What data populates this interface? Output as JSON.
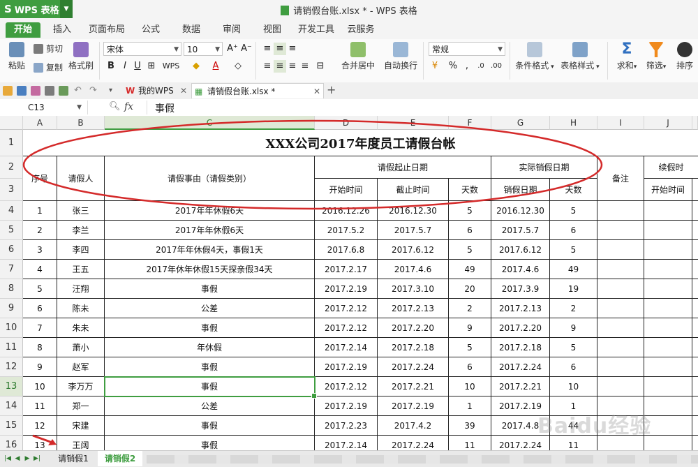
{
  "app": {
    "menu_label": "WPS 表格",
    "window_title": "请销假台账.xlsx * - WPS 表格"
  },
  "ribbon_tabs": [
    "开始",
    "插入",
    "页面布局",
    "公式",
    "数据",
    "审阅",
    "视图",
    "开发工具",
    "云服务"
  ],
  "ribbon": {
    "paste": "粘贴",
    "cut": "剪切",
    "copy": "复制",
    "format_painter": "格式刷",
    "font_name": "宋体",
    "font_size": "10",
    "merge_center": "合并居中",
    "wrap_text": "自动换行",
    "number_format": "常规",
    "conditional_format": "条件格式",
    "table_style": "表格样式",
    "sum": "求和",
    "filter": "筛选",
    "sort": "排序"
  },
  "doc_tabs": [
    {
      "label": "我的WPS"
    },
    {
      "label": "请销假台账.xlsx *"
    }
  ],
  "formula_bar": {
    "cell_ref": "C13",
    "fx": "fx",
    "content": "事假"
  },
  "columns": [
    "A",
    "B",
    "C",
    "D",
    "E",
    "F",
    "G",
    "H",
    "I",
    "J"
  ],
  "rows": [
    "1",
    "2",
    "3",
    "4",
    "5",
    "6",
    "7",
    "8",
    "9",
    "10",
    "11",
    "12",
    "13",
    "14",
    "15",
    "16"
  ],
  "sheet": {
    "title": "XXX公司2017年度员工请假台帐",
    "headers": {
      "seq": "序号",
      "person": "请假人",
      "reason": "请假事由（请假类别）",
      "leave_period": "请假起止日期",
      "start": "开始时间",
      "end": "截止时间",
      "days": "天数",
      "actual": "实际销假日期",
      "cancel_date": "销假日期",
      "actual_days": "天数",
      "note": "备注",
      "extend": "续假时",
      "extend_start": "开始时间"
    },
    "records": [
      [
        "1",
        "张三",
        "2017年年休假6天",
        "2016.12.26",
        "2016.12.30",
        "5",
        "2016.12.30",
        "5"
      ],
      [
        "2",
        "李兰",
        "2017年年休假6天",
        "2017.5.2",
        "2017.5.7",
        "6",
        "2017.5.7",
        "6"
      ],
      [
        "3",
        "李四",
        "2017年年休假4天，事假1天",
        "2017.6.8",
        "2017.6.12",
        "5",
        "2017.6.12",
        "5"
      ],
      [
        "4",
        "王五",
        "2017年休年休假15天探亲假34天",
        "2017.2.17",
        "2017.4.6",
        "49",
        "2017.4.6",
        "49"
      ],
      [
        "5",
        "汪翔",
        "事假",
        "2017.2.19",
        "2017.3.10",
        "20",
        "2017.3.9",
        "19"
      ],
      [
        "6",
        "陈未",
        "公差",
        "2017.2.12",
        "2017.2.13",
        "2",
        "2017.2.13",
        "2"
      ],
      [
        "7",
        "朱未",
        "事假",
        "2017.2.12",
        "2017.2.20",
        "9",
        "2017.2.20",
        "9"
      ],
      [
        "8",
        "萧小",
        "年休假",
        "2017.2.14",
        "2017.2.18",
        "5",
        "2017.2.18",
        "5"
      ],
      [
        "9",
        "赵军",
        "事假",
        "2017.2.19",
        "2017.2.24",
        "6",
        "2017.2.24",
        "6"
      ],
      [
        "10",
        "李万万",
        "事假",
        "2017.2.12",
        "2017.2.21",
        "10",
        "2017.2.21",
        "10"
      ],
      [
        "11",
        "郑一",
        "公差",
        "2017.2.19",
        "2017.2.19",
        "1",
        "2017.2.19",
        "1"
      ],
      [
        "12",
        "宋建",
        "事假",
        "2017.2.23",
        "2017.4.2",
        "39",
        "2017.4.8",
        "44"
      ],
      [
        "13",
        "王阔",
        "事假",
        "2017.2.14",
        "2017.2.24",
        "11",
        "2017.2.24",
        "11"
      ]
    ]
  },
  "sheet_tabs": [
    {
      "label": "请销假1"
    },
    {
      "label": "请销假2"
    }
  ],
  "watermark": "Baidu经验",
  "colors": {
    "accent": "#3f9d40",
    "annotation": "#d42a2a"
  }
}
